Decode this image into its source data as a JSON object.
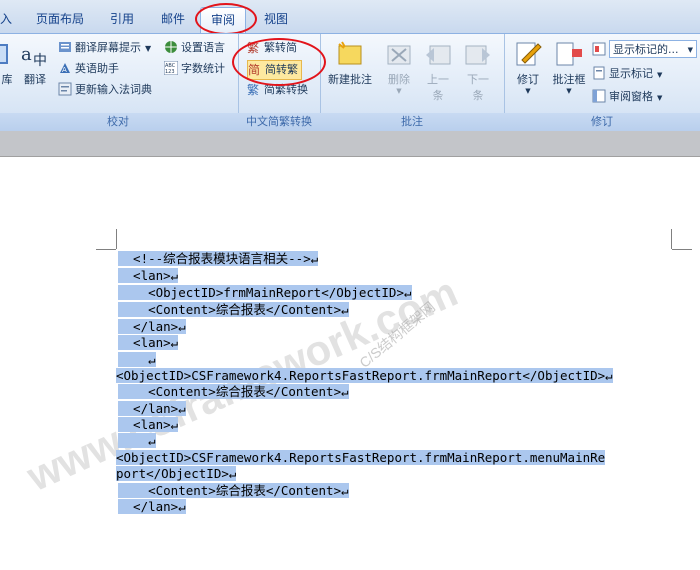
{
  "tabs": [
    "入",
    "页面布局",
    "引用",
    "邮件",
    "审阅",
    "视图"
  ],
  "active_tab": "审阅",
  "ribbon": {
    "proofing": {
      "label": "校对",
      "items": {
        "left_cut": "库",
        "translate": "翻译",
        "screen_tips": "翻译屏幕提示",
        "english_assistant": "英语助手",
        "update_ime": "更新输入法词典",
        "set_language": "设置语言",
        "word_count": "字数统计"
      }
    },
    "chinese_conversion": {
      "label": "中文简繁转换",
      "to_simplified": "繁转简",
      "to_traditional": "简转繁",
      "convert": "简繁转换"
    },
    "comments": {
      "label": "批注",
      "new": "新建批注",
      "delete": "删除",
      "previous": [
        "上一",
        "条"
      ],
      "next": [
        "下一",
        "条"
      ]
    },
    "tracking": {
      "label": "修订",
      "track_changes": "修订",
      "balloons": "批注框",
      "show_markup_select": "显示标记的...",
      "show_markup": "显示标记",
      "reviewing_pane": "审阅窗格"
    }
  },
  "document": {
    "lines": [
      "  <!--综合报表模块语言相关-->↵",
      "  <lan>↵",
      "    <ObjectID>frmMainReport</ObjectID>↵",
      "    <Content>综合报表</Content>↵",
      "  </lan>↵",
      "  <lan>↵",
      "    ↵",
      "<ObjectID>CSFramework4.ReportsFastReport.frmMainReport</ObjectID>↵",
      "    <Content>综合报表</Content>↵",
      "  </lan>↵",
      "  <lan>↵",
      "    ↵",
      "<ObjectID>CSFramework4.ReportsFastReport.frmMainReport.menuMainRe",
      "port</ObjectID>↵",
      "    <Content>综合报表</Content>↵",
      "  </lan>↵"
    ],
    "watermarks": [
      "www.csframework.com",
      "C/S结构框架网"
    ]
  },
  "colors": {
    "selection": "#abc7ee",
    "highlight_oval": "#e2141b",
    "ribbon_text": "#1e395b",
    "tab_text": "#15428b"
  }
}
